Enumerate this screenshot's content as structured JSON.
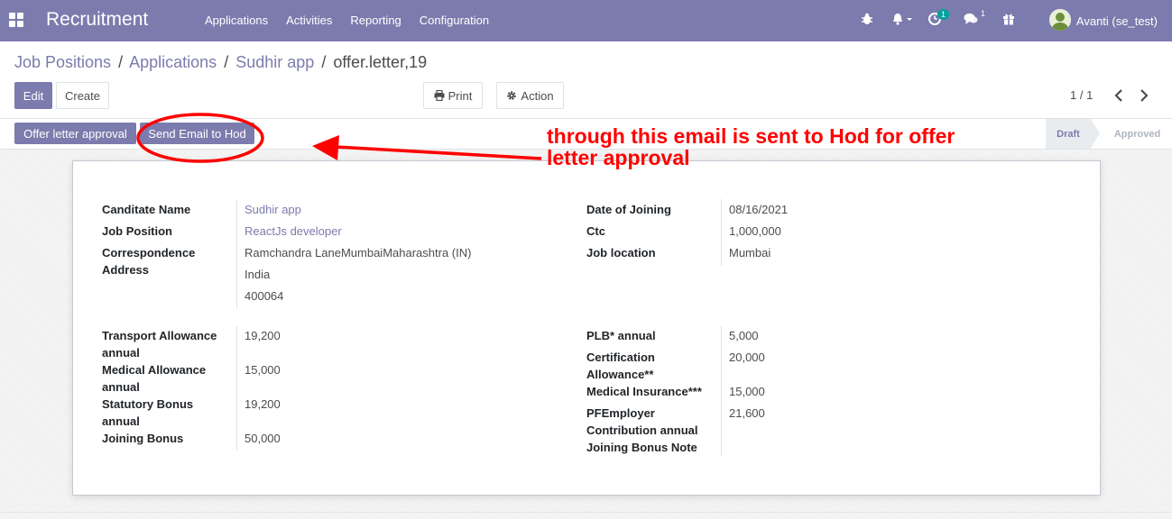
{
  "navbar": {
    "brand": "Recruitment",
    "menu": [
      "Applications",
      "Activities",
      "Reporting",
      "Configuration"
    ],
    "activity_badge": "1",
    "messages_badge": "1",
    "user": "Avanti (se_test)"
  },
  "breadcrumb": {
    "items": [
      "Job Positions",
      "Applications",
      "Sudhir app"
    ],
    "current": "offer.letter,19",
    "separator": "/"
  },
  "toolbar": {
    "edit_label": "Edit",
    "create_label": "Create",
    "print_label": "Print",
    "action_label": "Action",
    "pager": "1 / 1"
  },
  "statusbar": {
    "buttons": [
      "Offer letter approval",
      "Send Email to Hod"
    ],
    "stages": [
      "Draft",
      "Approved"
    ],
    "active_stage": "Draft"
  },
  "form": {
    "left_top": [
      {
        "label": "Canditate Name",
        "value": "Sudhir app"
      },
      {
        "label": "Job Position",
        "value": "ReactJs developer"
      },
      {
        "label_lines": [
          "Correspondence",
          "Address"
        ],
        "value_lines": [
          "Ramchandra LaneMumbaiMaharashtra (IN)",
          "India",
          "400064"
        ]
      }
    ],
    "right_top": [
      {
        "label": "Date of Joining",
        "value": "08/16/2021"
      },
      {
        "label": "Ctc",
        "value": "1,000,000"
      },
      {
        "label": "Job location",
        "value": "Mumbai"
      }
    ],
    "left_bottom": [
      {
        "label_lines": [
          "Transport Allowance",
          "annual"
        ],
        "value": "19,200"
      },
      {
        "label_lines": [
          "Medical Allowance",
          "annual"
        ],
        "value": "15,000"
      },
      {
        "label_lines": [
          "Statutory Bonus",
          "annual"
        ],
        "value": "19,200"
      },
      {
        "label": "Joining Bonus",
        "value": "50,000"
      }
    ],
    "right_bottom": [
      {
        "label": "PLB* annual",
        "value": "5,000"
      },
      {
        "label_lines": [
          "Certification",
          "Allowance**"
        ],
        "value": "20,000"
      },
      {
        "label": "Medical Insurance***",
        "value": "15,000"
      },
      {
        "label_lines": [
          "PFEmployer",
          "Contribution annual"
        ],
        "value": "21,600"
      },
      {
        "label": "Joining Bonus Note",
        "value": ""
      }
    ]
  },
  "annotation": {
    "line1": "through this email is sent to Hod for offer",
    "line2": "letter approval",
    "color": "#ff0000"
  },
  "colors": {
    "brand": "#7c7bad",
    "annotation": "#ff0000"
  }
}
